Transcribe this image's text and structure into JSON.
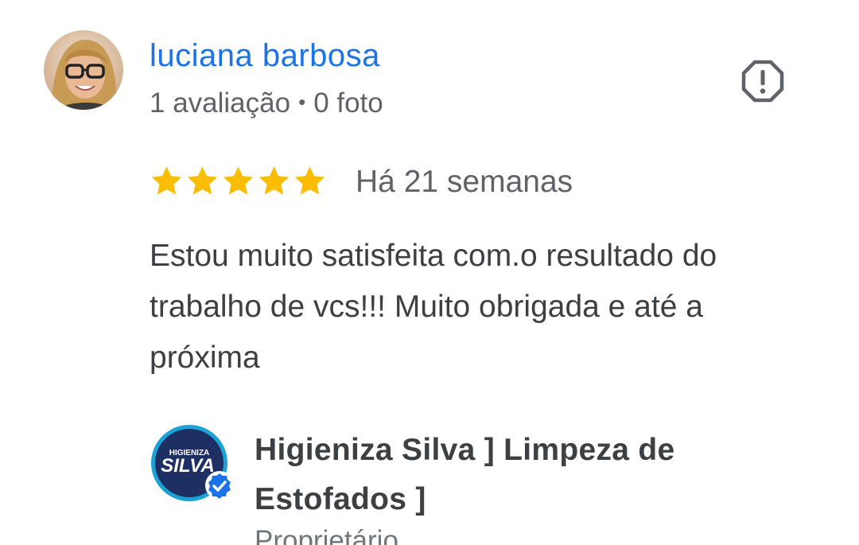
{
  "reviewer": {
    "name": "luciana barbosa",
    "reviews_count": "1 avaliação",
    "separator": "•",
    "photos_count": "0 foto"
  },
  "review": {
    "rating": 5,
    "max_rating": 5,
    "date": "Há 21 semanas",
    "text": "Estou muito satisfeita com.o resultado do trabalho de vcs!!! Muito obrigada e até a próxima"
  },
  "owner_response": {
    "business_name": "Higieniza Silva ] Limpeza de Estofados ]",
    "role": "Proprietário",
    "logo_text_small": "HIGIENIZA",
    "logo_text_big": "SILVA"
  },
  "icons": {
    "report": "report-flag-icon",
    "star": "star-icon",
    "verified": "verified-badge-icon"
  },
  "colors": {
    "name_link": "#1a73e8",
    "star": "#fbbc04",
    "meta_text": "#5f6368",
    "body_text": "#3c4043",
    "logo_ring": "#1aa3d4",
    "logo_bg": "#1d2f63",
    "verified": "#1a73e8"
  }
}
